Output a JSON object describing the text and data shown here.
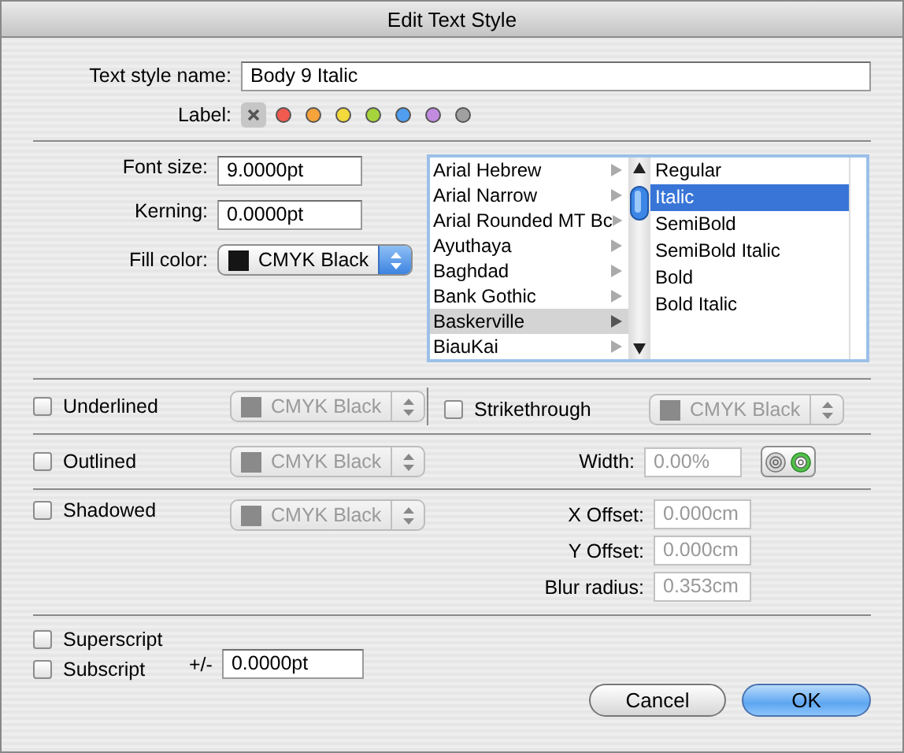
{
  "window": {
    "title": "Edit Text Style"
  },
  "name_field": {
    "label": "Text style name:",
    "value": "Body 9 Italic"
  },
  "label_picker": {
    "label": "Label:",
    "options": [
      {
        "kind": "none",
        "selected": true
      },
      {
        "kind": "color",
        "color": "#f05a4f",
        "selected": false
      },
      {
        "kind": "color",
        "color": "#f5a33a",
        "selected": false
      },
      {
        "kind": "color",
        "color": "#f2d93c",
        "selected": false
      },
      {
        "kind": "color",
        "color": "#a5d43c",
        "selected": false
      },
      {
        "kind": "color",
        "color": "#4f9ef0",
        "selected": false
      },
      {
        "kind": "color",
        "color": "#c18be0",
        "selected": false
      },
      {
        "kind": "color",
        "color": "#a0a0a0",
        "selected": false
      }
    ]
  },
  "font_size": {
    "label": "Font size:",
    "value": "9.0000pt"
  },
  "kerning": {
    "label": "Kerning:",
    "value": "0.0000pt"
  },
  "fill_color": {
    "label": "Fill color:",
    "value": "CMYK Black",
    "disabled": false
  },
  "font_families": [
    {
      "name": "Arial Hebrew",
      "selected": false
    },
    {
      "name": "Arial Narrow",
      "selected": false
    },
    {
      "name": "Arial Rounded MT Bc",
      "selected": false
    },
    {
      "name": "Ayuthaya",
      "selected": false
    },
    {
      "name": "Baghdad",
      "selected": false
    },
    {
      "name": "Bank Gothic",
      "selected": false
    },
    {
      "name": "Baskerville",
      "selected": true
    },
    {
      "name": "BiauKai",
      "selected": false
    }
  ],
  "typefaces": [
    {
      "name": "Regular",
      "selected": false
    },
    {
      "name": "Italic",
      "selected": true
    },
    {
      "name": "SemiBold",
      "selected": false
    },
    {
      "name": "SemiBold Italic",
      "selected": false
    },
    {
      "name": "Bold",
      "selected": false
    },
    {
      "name": "Bold Italic",
      "selected": false
    }
  ],
  "underline": {
    "label": "Underlined",
    "checked": false,
    "color": {
      "value": "CMYK Black",
      "disabled": true
    }
  },
  "strikethrough": {
    "label": "Strikethrough",
    "checked": false,
    "color": {
      "value": "CMYK Black",
      "disabled": true
    }
  },
  "outline": {
    "label": "Outlined",
    "checked": false,
    "color": {
      "value": "CMYK Black",
      "disabled": true
    },
    "width": {
      "label": "Width:",
      "value": "0.00%",
      "disabled": true
    },
    "modes": [
      {
        "selected": false
      },
      {
        "selected": true
      }
    ]
  },
  "shadow": {
    "label": "Shadowed",
    "checked": false,
    "color": {
      "value": "CMYK Black",
      "disabled": true
    },
    "fields": [
      {
        "label": "X Offset:",
        "value": "0.000cm",
        "disabled": true
      },
      {
        "label": "Y Offset:",
        "value": "0.000cm",
        "disabled": true
      },
      {
        "label": "Blur radius:",
        "value": "0.353cm",
        "disabled": true
      }
    ]
  },
  "superscript": {
    "label": "Superscript",
    "checked": false
  },
  "subscript": {
    "label": "Subscript",
    "checked": false
  },
  "offset": {
    "label": "+/-",
    "value": "0.0000pt"
  },
  "buttons": [
    {
      "label": "Cancel",
      "default": false
    },
    {
      "label": "OK",
      "default": true
    }
  ]
}
